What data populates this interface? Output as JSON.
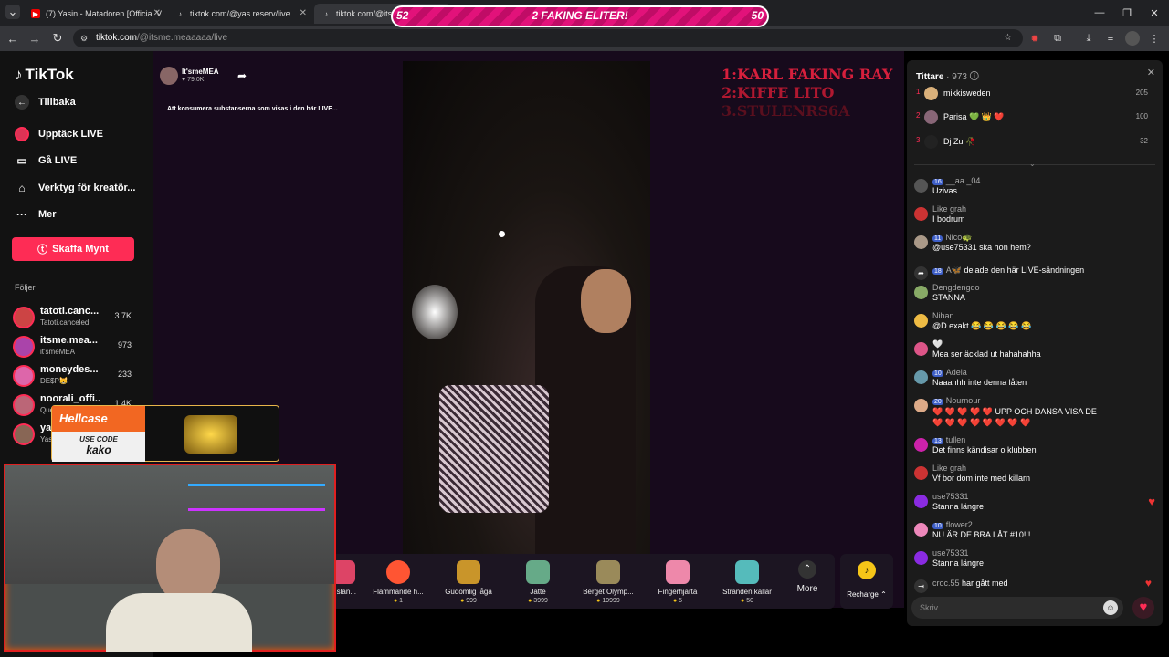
{
  "tabs": [
    {
      "title": "(7) Yasin - Matadoren [Official V"
    },
    {
      "title": "tiktok.com/@yas.reserv/live"
    },
    {
      "title": "tiktok.com/@itsme"
    }
  ],
  "address": {
    "host": "tiktok.com",
    "path": "/@itsme.meaaaaa/live"
  },
  "banner": {
    "left": "52",
    "center": "2 FAKING ELITER!",
    "right": "50"
  },
  "overlay_list": [
    "1:KARL FAKING RAY",
    "2:KIFFE LITO",
    "3.STULENRS6A"
  ],
  "sidebar": {
    "logo": "TikTok",
    "back": "Tillbaka",
    "nav": [
      "Upptäck LIVE",
      "Gå LIVE",
      "Verktyg för kreatör...",
      "Mer"
    ],
    "buy_coins": "Skaffa Mynt",
    "following_header": "Följer",
    "following": [
      {
        "name": "tatoti.canc...",
        "sub": "Tatoti.canceled",
        "count": "3.7K"
      },
      {
        "name": "itsme.mea...",
        "sub": "it'smeMEA",
        "count": "973"
      },
      {
        "name": "moneydes...",
        "sub": "DE$P😸",
        "count": "233"
      },
      {
        "name": "noorali_offi...",
        "sub": "Que",
        "count": "1.4K"
      },
      {
        "name": "ya",
        "sub": "Yas",
        "count": ""
      }
    ]
  },
  "stream": {
    "host_name": "It'smeMEA",
    "likes": "79.0K",
    "notice": "Att konsumera substanserna som visas i den här LIVE..."
  },
  "gifts": [
    {
      "name": "...slän...",
      "price": ""
    },
    {
      "name": "Flammande h...",
      "price": "1"
    },
    {
      "name": "Gudomlig låga",
      "price": "999"
    },
    {
      "name": "Jätte",
      "price": "3999"
    },
    {
      "name": "Berget Olymp...",
      "price": "19999"
    },
    {
      "name": "Fingerhjärta",
      "price": "5"
    },
    {
      "name": "Stranden kallar",
      "price": "50"
    }
  ],
  "more_label": "More",
  "recharge_label": "Recharge",
  "hellcase": {
    "brand": "Hellcase",
    "use_code": "USE CODE",
    "code": "kako"
  },
  "chat": {
    "viewers_label": "Tittare",
    "viewers_count": "· 973",
    "top_viewers": [
      {
        "rank": "1",
        "name": "mikkisweden",
        "score": "205"
      },
      {
        "rank": "2",
        "name": "Parisa 💚 👑 ❤️",
        "score": "100"
      },
      {
        "rank": "3",
        "name": "Dj Zu 🥀",
        "score": "32"
      }
    ],
    "messages": [
      {
        "badge": "16",
        "user": "__aa._04",
        "text": "Uzivas"
      },
      {
        "badge": "",
        "user": "Like grah",
        "text": "I bodrum"
      },
      {
        "badge": "11",
        "user": "Nico🐢",
        "text": "@use75331 ska hon hem?"
      },
      {
        "badge": "18",
        "user": "A🦋",
        "text": "delade den här LIVE-sändningen"
      },
      {
        "badge": "",
        "user": "Dengdengdo",
        "text": "STANNA"
      },
      {
        "badge": "",
        "user": "Nihan",
        "text": "@D exakt 😂 😂 😂 😂 😂"
      },
      {
        "badge": "",
        "user": "🤍",
        "text": "Mea ser äcklad ut hahahahha"
      },
      {
        "badge": "10",
        "user": "Adela",
        "text": "Naaahhh inte denna låten"
      },
      {
        "badge": "20",
        "user": "Nournour",
        "text": "❤️ ❤️ ❤️ ❤️ ❤️ UPP OCH DANSA VISA DE ❤️ ❤️ ❤️ ❤️ ❤️ ❤️ ❤️ ❤️"
      },
      {
        "badge": "13",
        "user": "tullen",
        "text": "Det finns kändisar o klubben"
      },
      {
        "badge": "",
        "user": "Like grah",
        "text": "Vf bor dom inte med killarn"
      },
      {
        "badge": "",
        "user": "use75331",
        "text": "Stanna längre"
      },
      {
        "badge": "10",
        "user": "flower2",
        "text": "NU ÄR DE BRA LÅT #10!!!"
      },
      {
        "badge": "",
        "user": "use75331",
        "text": "Stanna längre"
      },
      {
        "badge": "",
        "user": "croc.55",
        "text": "har gått med"
      }
    ],
    "input_placeholder": "Skriv ..."
  },
  "colors": {
    "accent": "#fe2c55",
    "badge": "#3d5ec7"
  }
}
